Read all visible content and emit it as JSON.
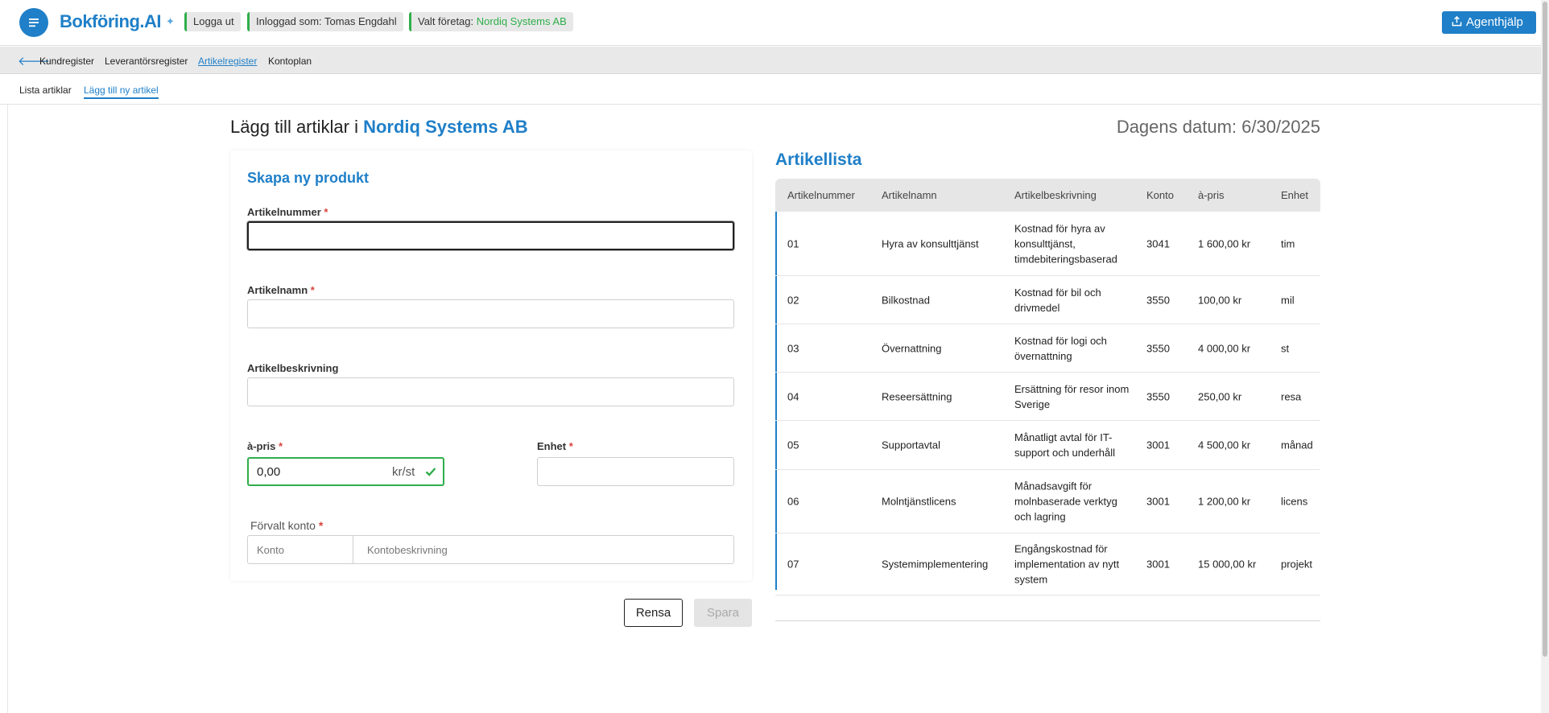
{
  "topbar": {
    "brand": "Bokföring.AI",
    "brand_sparkle": "✦",
    "logout": "Logga ut",
    "logged_in_as": "Inloggad som: Tomas Engdahl",
    "selected_company_label": "Valt företag:",
    "selected_company": "Nordiq Systems AB",
    "agent_help": "Agenthjälp"
  },
  "subnav": {
    "items": [
      "Kundregister",
      "Leverantörsregister",
      "Artikelregister",
      "Kontoplan"
    ]
  },
  "tabs": [
    "Lista artiklar",
    "Lägg till ny artikel"
  ],
  "page": {
    "title_prefix": "Lägg till artiklar i",
    "company": "Nordiq Systems AB",
    "today": "Dagens datum: 6/30/2025"
  },
  "form": {
    "title": "Skapa ny produkt",
    "article_number_label": "Artikelnummer",
    "article_name_label": "Artikelnamn",
    "description_label": "Artikelbeskrivning",
    "price_label": "à-pris",
    "price_value": "0,00",
    "price_unit": "kr/st",
    "unit_label": "Enhet",
    "account_label": "Förvalt konto",
    "account_placeholder": "Konto",
    "account_desc_placeholder": "Kontobeskrivning",
    "required_mark": "*",
    "clear_button": "Rensa",
    "save_button": "Spara"
  },
  "article_list": {
    "title": "Artikellista",
    "columns": [
      "Artikelnummer",
      "Artikelnamn",
      "Artikelbeskrivning",
      "Konto",
      "à-pris",
      "Enhet"
    ],
    "rows": [
      {
        "number": "01",
        "name": "Hyra av konsulttjänst",
        "description": "Kostnad för hyra av konsulttjänst, timdebiteringsbaserad",
        "account": "3041",
        "price": "1 600,00 kr",
        "unit": "tim"
      },
      {
        "number": "02",
        "name": "Bilkostnad",
        "description": "Kostnad för bil och drivmedel",
        "account": "3550",
        "price": "100,00 kr",
        "unit": "mil"
      },
      {
        "number": "03",
        "name": "Övernattning",
        "description": "Kostnad för logi och övernattning",
        "account": "3550",
        "price": "4 000,00 kr",
        "unit": "st"
      },
      {
        "number": "04",
        "name": "Reseersättning",
        "description": "Ersättning för resor inom Sverige",
        "account": "3550",
        "price": "250,00 kr",
        "unit": "resa"
      },
      {
        "number": "05",
        "name": "Supportavtal",
        "description": "Månatligt avtal för IT-support och underhåll",
        "account": "3001",
        "price": "4 500,00 kr",
        "unit": "månad"
      },
      {
        "number": "06",
        "name": "Molntjänstlicens",
        "description": "Månadsavgift för molnbaserade verktyg och lagring",
        "account": "3001",
        "price": "1 200,00 kr",
        "unit": "licens"
      },
      {
        "number": "07",
        "name": "Systemimplementering",
        "description": "Engångskostnad för implementation av nytt system",
        "account": "3001",
        "price": "15 000,00 kr",
        "unit": "projekt"
      }
    ]
  },
  "colors": {
    "accent": "#1f7fc8",
    "success": "#2fae4a",
    "required": "#d9443f"
  },
  "icons": {
    "menu": "menu-icon",
    "agent": "upload-icon",
    "back": "arrow-left-icon",
    "check": "check-icon"
  }
}
